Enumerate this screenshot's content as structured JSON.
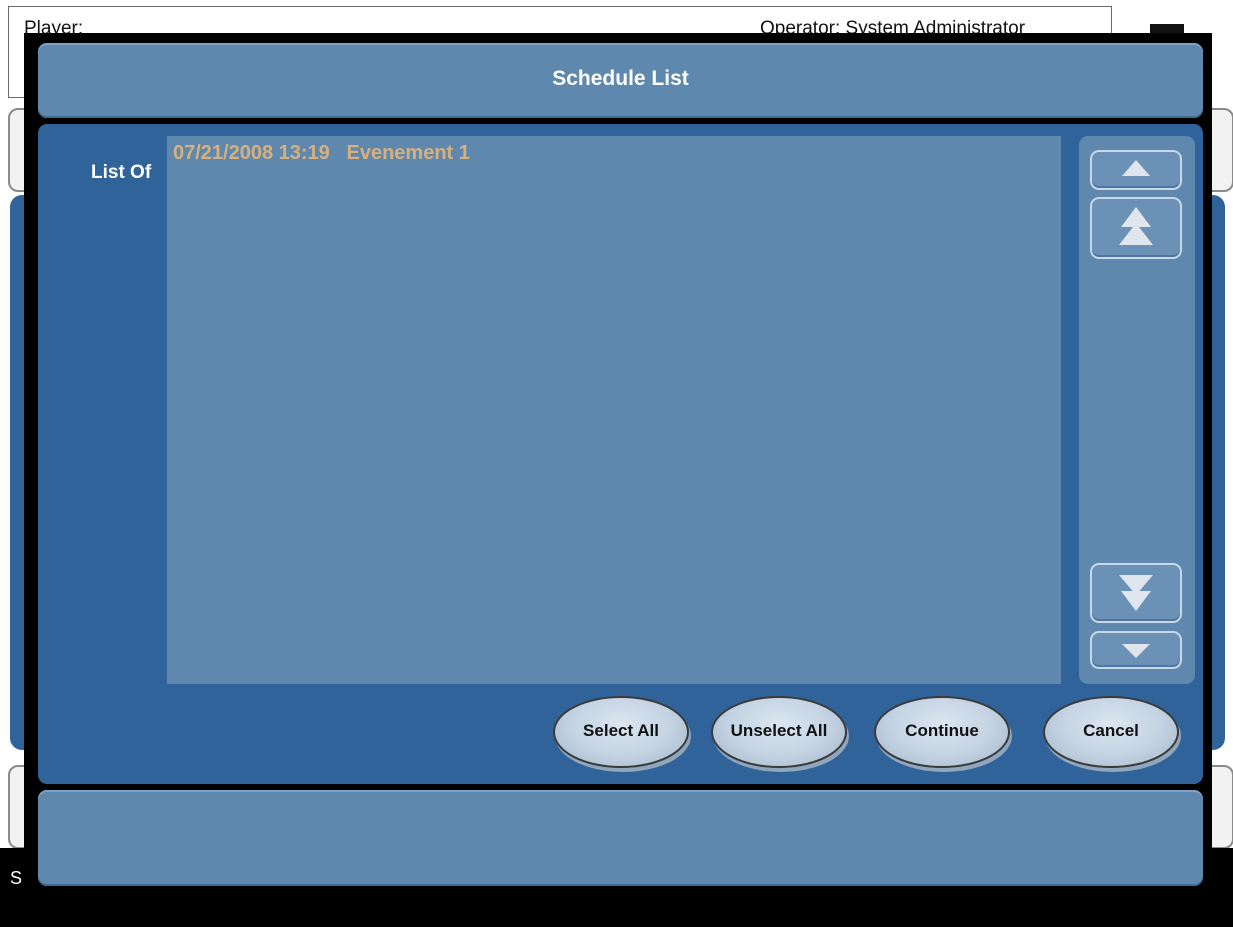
{
  "background": {
    "player_label": "Player:",
    "operator_text": "Operator:  System Administrator",
    "status_text": "S          y"
  },
  "dialog": {
    "title": "Schedule List",
    "list_label": "List Of",
    "items": [
      {
        "date": "07/21/2008 13:19",
        "name": "Evenement 1"
      }
    ],
    "buttons": {
      "select_all": "Select All",
      "unselect_all": "Unselect All",
      "continue": "Continue",
      "cancel": "Cancel"
    },
    "scroll_buttons": [
      "line-up",
      "page-up",
      "page-down",
      "line-down"
    ]
  },
  "colors": {
    "panel": "#5f88af",
    "panel_dark": "#2f6399",
    "list_text": "#d7b07c",
    "title_text": "#ffffff"
  }
}
